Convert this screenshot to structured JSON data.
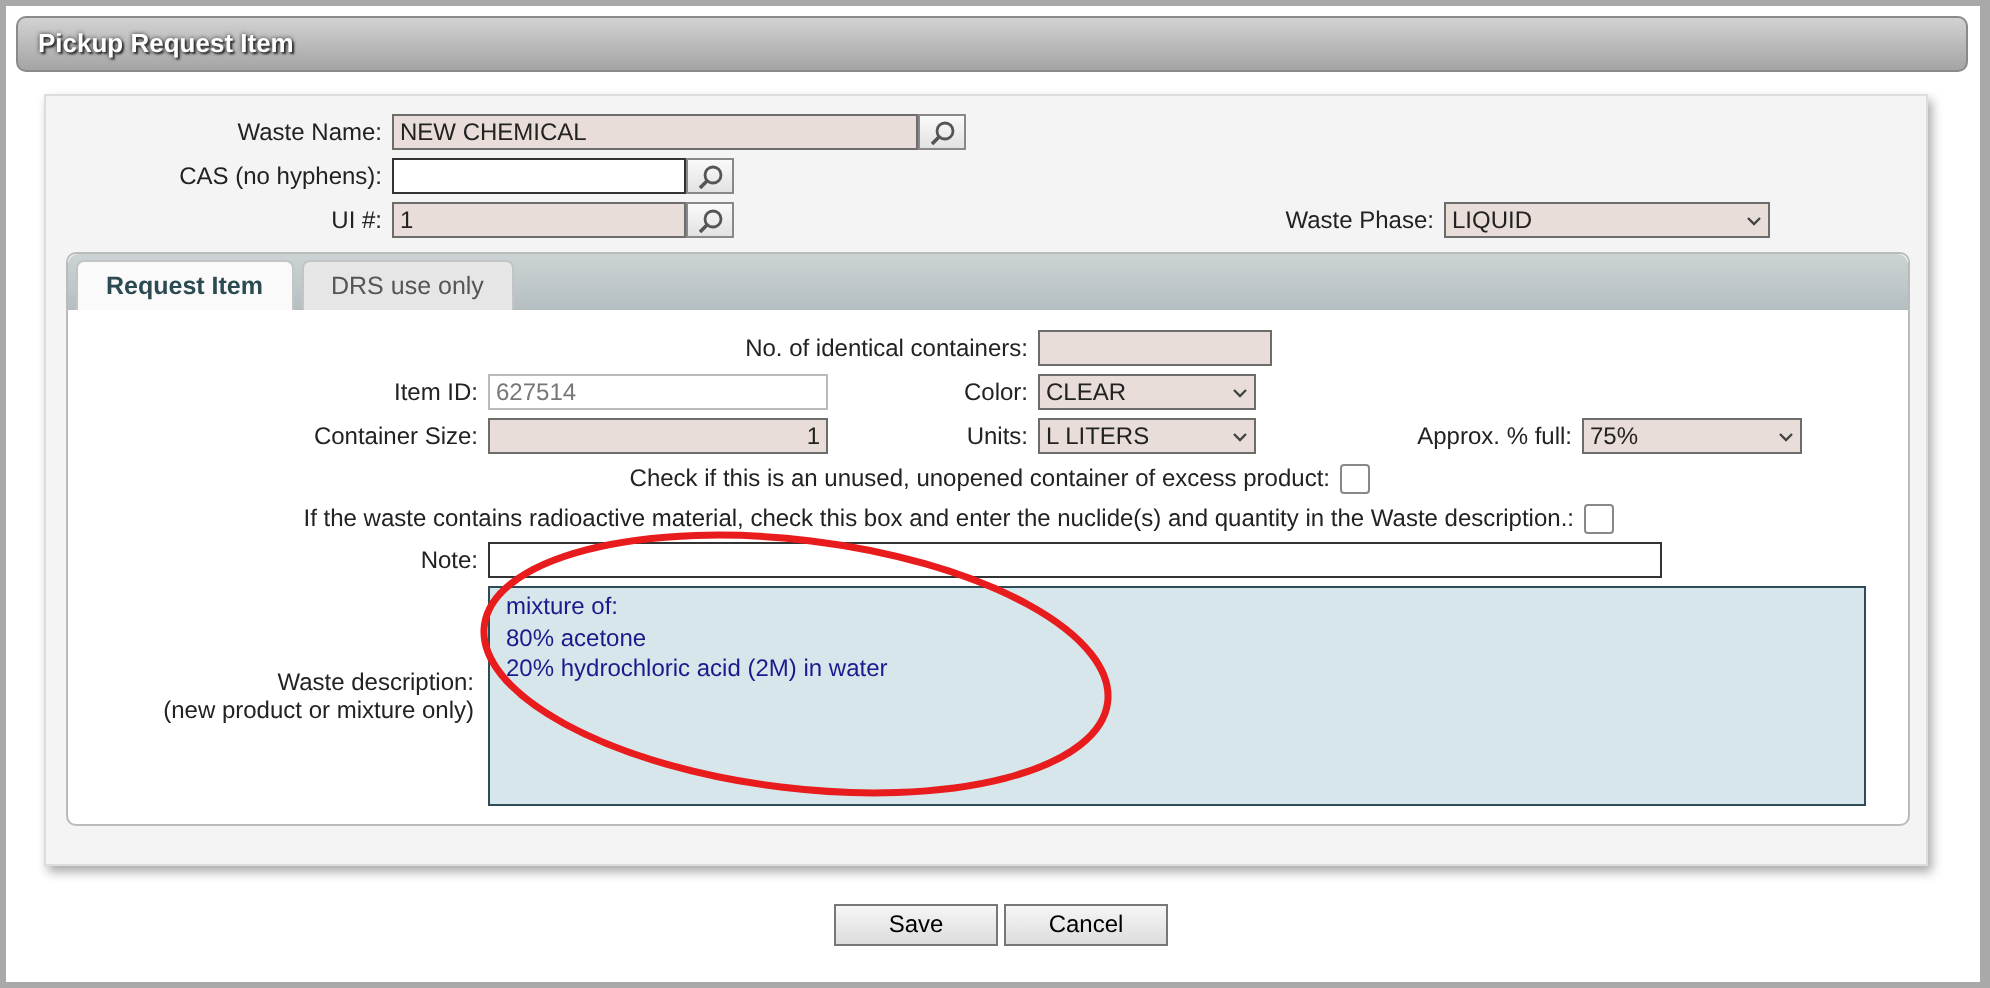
{
  "window": {
    "title": "Pickup Request Item"
  },
  "waste_name": {
    "label": "Waste Name:",
    "value": "NEW CHEMICAL"
  },
  "cas": {
    "label": "CAS (no hyphens):"
  },
  "ui_number": {
    "label": "UI #:",
    "value": "1"
  },
  "waste_phase": {
    "label": "Waste Phase:",
    "value": "LIQUID"
  },
  "tabs": [
    {
      "label": "Request Item",
      "selected": true
    },
    {
      "label": "DRS use only",
      "selected": false
    }
  ],
  "request_item": {
    "containers_count": {
      "label": "No. of identical containers:"
    },
    "item_id": {
      "label": "Item ID:",
      "value": "627514",
      "disabled": true
    },
    "color": {
      "label": "Color:",
      "value": "CLEAR"
    },
    "container_size": {
      "label": "Container Size:",
      "value": "1"
    },
    "units": {
      "label": "Units:",
      "value": "L LITERS"
    },
    "approx_full": {
      "label": "Approx. % full:",
      "value": "75%"
    },
    "unused_container": {
      "label": "Check if this is an unused, unopened container of excess product:",
      "checked": false
    },
    "radioactive": {
      "label": "If the waste contains radioactive material, check this box and enter the nuclide(s) and quantity in the Waste description.:",
      "checked": false
    },
    "note": {
      "label": "Note:"
    },
    "waste_description": {
      "label": "Waste description:",
      "hint": "(new product or mixture only)",
      "value": "mixture of:\n80% acetone\n20% hydrochloric acid (2M) in water"
    }
  },
  "annotation": {
    "kind": "ellipse",
    "color": "#e81c1c"
  },
  "buttons": [
    "Save",
    "Cancel"
  ]
}
